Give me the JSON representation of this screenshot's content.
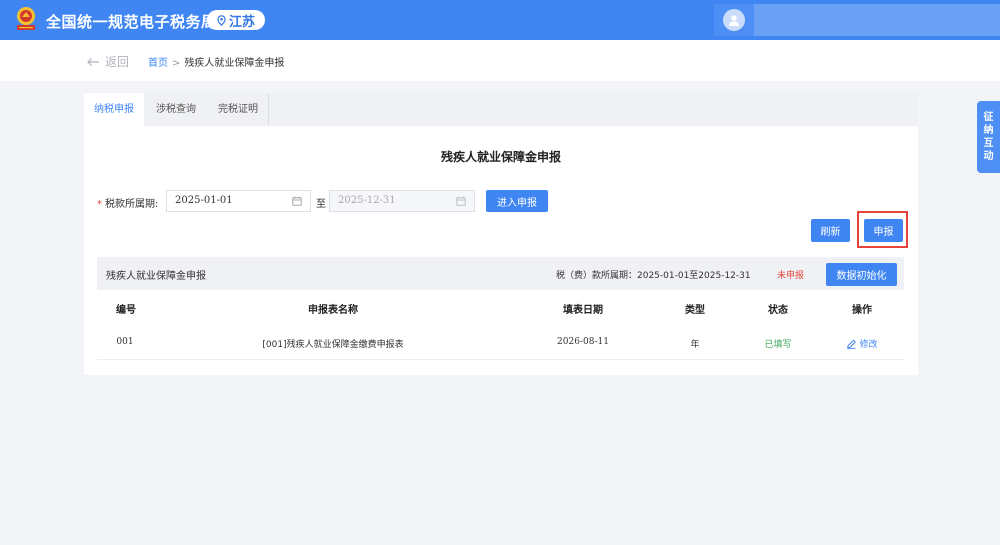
{
  "header": {
    "title": "全国统一规范电子税务局",
    "region": "江苏"
  },
  "breadcrumb": {
    "back_label": "返回",
    "home": "首页",
    "separator": ">",
    "current": "残疾人就业保障金申报"
  },
  "tabs": [
    {
      "label": "纳税申报",
      "active": true
    },
    {
      "label": "涉税查询",
      "active": false
    },
    {
      "label": "完税证明",
      "active": false
    }
  ],
  "form": {
    "title": "残疾人就业保障金申报",
    "required_mark": "*",
    "period_label": "税款所属期:",
    "start_date": "2025-01-01",
    "to_label": "至",
    "end_date": "2025-12-31",
    "enter_button": "进入申报",
    "refresh_button": "刷新",
    "declare_button": "申报"
  },
  "section": {
    "title": "残疾人就业保障金申报",
    "period_text": "税（费）款所属期：2025-01-01至2025-12-31",
    "status": "未申报",
    "init_button": "数据初始化"
  },
  "table": {
    "columns": [
      "编号",
      "申报表名称",
      "填表日期",
      "类型",
      "状态",
      "操作"
    ],
    "rows": [
      {
        "id": "001",
        "name": "[001]残疾人就业保障金缴费申报表",
        "date": "2026-08-11",
        "type": "年",
        "status": "已填写",
        "action": "修改"
      }
    ]
  },
  "side_float": {
    "chars": [
      "征",
      "纳",
      "互",
      "动"
    ]
  },
  "colors": {
    "primary": "#3f86f3",
    "danger": "#e5443d",
    "success": "#3aa65a"
  }
}
